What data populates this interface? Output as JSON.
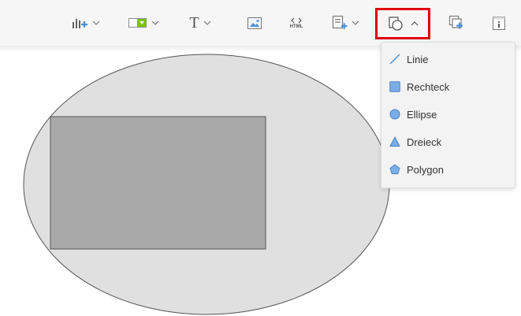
{
  "toolbar": {
    "buttons": [
      {
        "name": "chart-button",
        "icon": "chart-plus-icon",
        "has_chevron": true
      },
      {
        "name": "table-button",
        "icon": "table-icon",
        "has_chevron": true
      },
      {
        "name": "text-button",
        "icon": "text-icon",
        "glyph": "T",
        "has_chevron": true
      },
      {
        "name": "image-button",
        "icon": "image-icon",
        "has_chevron": false
      },
      {
        "name": "html-button",
        "icon": "html-icon",
        "label": "HTML",
        "has_chevron": false
      },
      {
        "name": "form-button",
        "icon": "form-plus-icon",
        "has_chevron": true
      },
      {
        "name": "shapes-button",
        "icon": "shapes-icon",
        "has_chevron": true,
        "state": "open"
      },
      {
        "name": "layer-button",
        "icon": "layer-plus-icon",
        "has_chevron": false
      },
      {
        "name": "info-button",
        "icon": "info-icon",
        "has_chevron": false
      }
    ]
  },
  "shapes_menu": {
    "items": [
      {
        "label": "Linie",
        "icon": "line-icon"
      },
      {
        "label": "Rechteck",
        "icon": "rectangle-icon"
      },
      {
        "label": "Ellipse",
        "icon": "ellipse-icon"
      },
      {
        "label": "Dreieck",
        "icon": "triangle-icon"
      },
      {
        "label": "Polygon",
        "icon": "polygon-icon"
      }
    ]
  },
  "canvas": {
    "shapes": [
      {
        "type": "ellipse",
        "fill": "#e0e0e0",
        "stroke": "#555555"
      },
      {
        "type": "rectangle",
        "fill": "#a9a9a9",
        "stroke": "#555555"
      }
    ]
  },
  "colors": {
    "accent_blue": "#4a90d9",
    "icon_gray": "#666666",
    "highlight_red": "#e00000",
    "table_green": "#7cc400"
  }
}
